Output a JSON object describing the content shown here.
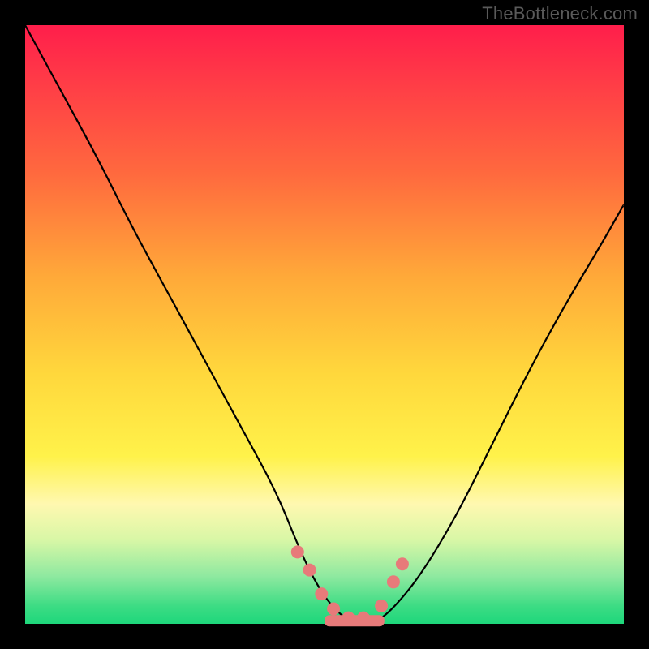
{
  "watermark": "TheBottleneck.com",
  "chart_data": {
    "type": "line",
    "title": "",
    "xlabel": "",
    "ylabel": "",
    "xlim": [
      0,
      100
    ],
    "ylim": [
      0,
      100
    ],
    "grid": false,
    "legend": false,
    "series": [
      {
        "name": "curve",
        "x": [
          0,
          6,
          12,
          18,
          24,
          30,
          36,
          42,
          46,
          49,
          52,
          55,
          58,
          61,
          66,
          72,
          78,
          84,
          90,
          96,
          100
        ],
        "y": [
          100,
          89,
          78,
          66,
          55,
          44,
          33,
          22,
          12,
          6,
          2,
          0,
          0,
          2,
          8,
          18,
          30,
          42,
          53,
          63,
          70
        ]
      }
    ],
    "markers": {
      "x": [
        45.5,
        47.5,
        49.5,
        51.5,
        54,
        56.5,
        59.5,
        61.5,
        63
      ],
      "y": [
        12,
        9,
        5,
        2.5,
        1,
        1,
        3,
        7,
        10
      ]
    },
    "bottom_bar": {
      "x_start": 50,
      "x_end": 60,
      "y": 0.5
    },
    "colors": {
      "line": "#000000",
      "marker": "#e77a7a",
      "gradient_top": "#ff1e4b",
      "gradient_bottom": "#1ed77b"
    }
  }
}
